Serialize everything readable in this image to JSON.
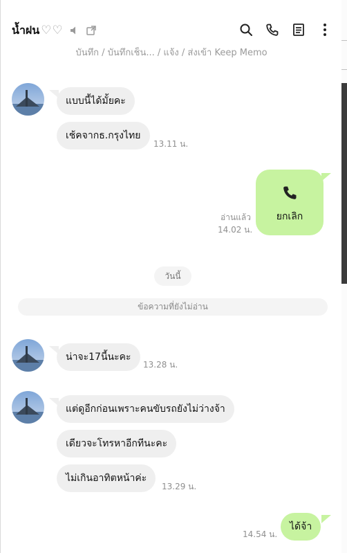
{
  "header": {
    "chat_name": "น้ำฝน",
    "hearts": "♡♡",
    "memo_line": "บันทึก / บันทึกเช็น... / แจ้ง / ส่งเข้า Keep Memo"
  },
  "messages": [
    {
      "id": "m1",
      "text": "แบบนี้ได้มั้ยคะ"
    },
    {
      "id": "m2",
      "text": "เช้คจากธ.กรุงไทย",
      "time": "13.11 น."
    },
    {
      "id": "call",
      "label": "ยกเลิก",
      "read": "อ่านแล้ว",
      "time": "14.02 น."
    },
    {
      "id": "m3",
      "text": "น่าจะ17นี้นะคะ",
      "time": "13.28 น."
    },
    {
      "id": "m4",
      "text": "แต่ดูอีกก่อนเพราะคนขับรถยังไม่ว่างจ้า"
    },
    {
      "id": "m5",
      "text": "เดียวจะโทรหาอีกทีนะคะ"
    },
    {
      "id": "m6",
      "text": "ไม่เกินอาทิตหน้าค่ะ",
      "time": "13.29 น."
    },
    {
      "id": "m7",
      "text": "ได้จ้า",
      "time": "14.54 น."
    }
  ],
  "date_divider": "วันนี้",
  "unread_divider": "ข้อความที่ยังไม่อ่าน",
  "colors": {
    "my_bubble": "#c7f3a0",
    "their_bubble": "#efefef"
  },
  "icons": [
    "mute-icon",
    "popout-icon",
    "search-icon",
    "phone-icon",
    "notes-icon",
    "more-vertical-icon"
  ]
}
